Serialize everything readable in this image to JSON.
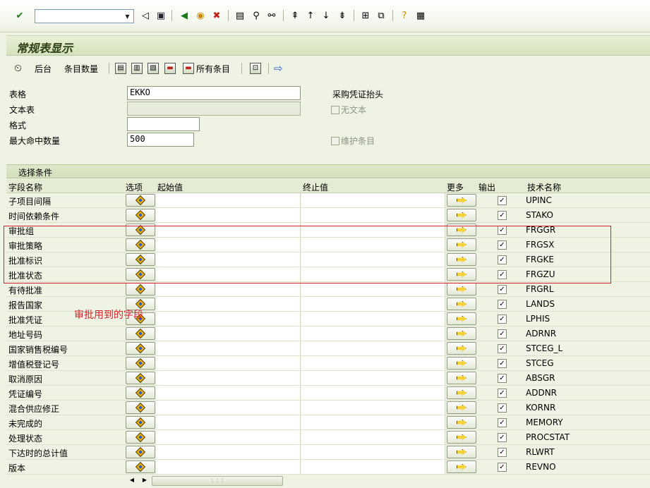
{
  "system_toolbar": {
    "command_field_value": "",
    "icons": [
      "enter-icon",
      "save-icon",
      "back-icon",
      "exit-icon",
      "cancel-icon",
      "print-icon",
      "find-icon",
      "find-next-icon",
      "first-page-icon",
      "previous-page-icon",
      "next-page-icon",
      "last-page-icon",
      "create-session-icon",
      "shortcut-icon",
      "help-icon",
      "customize-layout-icon"
    ]
  },
  "title": "常规表显示",
  "app_toolbar": {
    "background": "后台",
    "entry_count": "条目数量",
    "all_entries": "所有条目"
  },
  "form": {
    "table_label": "表格",
    "table_value": "EKKO",
    "table_description": "采购凭证抬头",
    "text_table_label": "文本表",
    "text_table_value": "",
    "no_text_label": "无文本",
    "layout_label": "格式",
    "layout_value": "",
    "max_hits_label": "最大命中数量",
    "max_hits_value": "500",
    "maintain_entries_label": "维护条目"
  },
  "selection": {
    "header": "选择条件",
    "columns": {
      "field_name": "字段名称",
      "option": "选项",
      "from": "起始值",
      "to": "终止值",
      "more": "更多",
      "output": "输出",
      "tech_name": "技术名称"
    },
    "rows": [
      {
        "field": "子项目间隔",
        "tech": "UPINC",
        "output": "✓"
      },
      {
        "field": "时间依赖条件",
        "tech": "STAKO",
        "output": "✓"
      },
      {
        "field": "审批组",
        "tech": "FRGGR",
        "output": "✓"
      },
      {
        "field": "审批策略",
        "tech": "FRGSX",
        "output": "✓"
      },
      {
        "field": "批准标识",
        "tech": "FRGKE",
        "output": "✓"
      },
      {
        "field": "批准状态",
        "tech": "FRGZU",
        "output": "✓"
      },
      {
        "field": "有待批准",
        "tech": "FRGRL",
        "output": "✓"
      },
      {
        "field": "报告国家",
        "tech": "LANDS",
        "output": "✓"
      },
      {
        "field": "批准凭证",
        "tech": "LPHIS",
        "output": "✓"
      },
      {
        "field": "地址号码",
        "tech": "ADRNR",
        "output": "✓"
      },
      {
        "field": "国家销售税编号",
        "tech": "STCEG_L",
        "output": "✓"
      },
      {
        "field": "增值税登记号",
        "tech": "STCEG",
        "output": "✓"
      },
      {
        "field": "取消原因",
        "tech": "ABSGR",
        "output": "✓"
      },
      {
        "field": "凭证编号",
        "tech": "ADDNR",
        "output": "✓"
      },
      {
        "field": "混合供应修正",
        "tech": "KORNR",
        "output": "✓"
      },
      {
        "field": "未完成的",
        "tech": "MEMORY",
        "output": "✓"
      },
      {
        "field": "处理状态",
        "tech": "PROCSTAT",
        "output": "✓"
      },
      {
        "field": "下达时的总计值",
        "tech": "RLWRT",
        "output": "✓"
      },
      {
        "field": "版本",
        "tech": "REVNO",
        "output": "✓"
      }
    ]
  },
  "annotation": "审批用到的字段",
  "colors": {
    "background": "#eef3e3",
    "highlight_red": "#d6202a",
    "title_text": "#2a3d14"
  }
}
